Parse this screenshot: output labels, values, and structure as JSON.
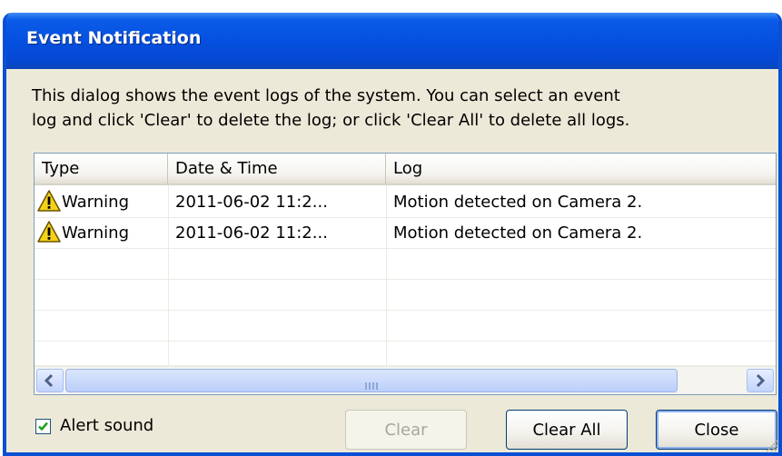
{
  "window": {
    "title": "Event Notification"
  },
  "description": "This dialog shows the event logs of the system. You can select an event\nlog and click 'Clear' to delete the log; or click 'Clear All' to delete all logs.",
  "table": {
    "columns": [
      "Type",
      "Date & Time",
      "Log"
    ],
    "rows": [
      {
        "type": "Warning",
        "datetime": "2011-06-02 11:2...",
        "log": "Motion detected on Camera 2.",
        "icon": "warning-icon"
      },
      {
        "type": "Warning",
        "datetime": "2011-06-02 11:2...",
        "log": "Motion detected on Camera 2.",
        "icon": "warning-icon"
      }
    ],
    "scrollbar": {
      "grip_label": "III"
    }
  },
  "alert_sound": {
    "label": "Alert sound",
    "checked": true
  },
  "buttons": {
    "clear": "Clear",
    "clear_all": "Clear All",
    "close": "Close"
  },
  "colors": {
    "titlebar": "#0550e0",
    "window_bg": "#ece9d8",
    "warning": "#f5d21a"
  }
}
